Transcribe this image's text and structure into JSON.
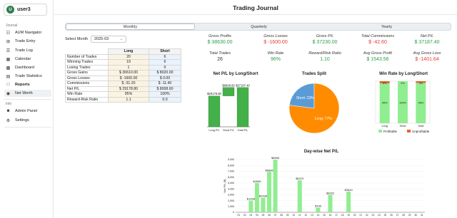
{
  "sidebar": {
    "user_initial": "U",
    "user_name": "user3",
    "section_journal": "Journal",
    "journal_items": [
      {
        "label": "AUM Navigator",
        "icon": "navigator-icon"
      },
      {
        "label": "Trade Entry",
        "icon": "plus-icon"
      },
      {
        "label": "Trade Log",
        "icon": "list-icon"
      },
      {
        "label": "Calendar",
        "icon": "calendar-icon"
      },
      {
        "label": "Dashboard",
        "icon": "dashboard-icon"
      },
      {
        "label": "Trade Statistics",
        "icon": "statistics-icon"
      },
      {
        "label": "Reports",
        "icon": "reports-icon"
      },
      {
        "label": "Net Worth",
        "icon": "dollar-icon"
      }
    ],
    "section_info": "Info",
    "info_items": [
      {
        "label": "Admin Panel",
        "icon": "person-icon"
      },
      {
        "label": "Settings",
        "icon": "gear-icon"
      }
    ]
  },
  "header": {
    "title": "Trading Journal"
  },
  "tabs": [
    "Monthly",
    "Quarterly",
    "Yearly"
  ],
  "month_select": {
    "label": "Select Month",
    "value": "2025-03"
  },
  "stats_table": {
    "headers": [
      "",
      "Long",
      "Short"
    ],
    "rows": [
      [
        "Number of Trades",
        "20",
        "6"
      ],
      [
        "Winning Trades",
        "19",
        "6"
      ],
      [
        "Losing Trades",
        "1",
        "0"
      ],
      [
        "Gross Gains",
        "$ 30610.00",
        "$ 8020.00"
      ],
      [
        "Gross Losses",
        "$ -1600.00",
        "$ 0.00"
      ],
      [
        "Commissions",
        "$ -31.20",
        "$ -11.40"
      ],
      [
        "Net P/L",
        "$ 29178.80",
        "$ 8008.60"
      ],
      [
        "Win Rate",
        "95%",
        "100%"
      ],
      [
        "Reward-Risk Ratio",
        "1.1",
        "0.0"
      ]
    ]
  },
  "metrics": [
    {
      "label": "Gross Profits",
      "value": "$ 38630.00",
      "color": "#2e9e4a"
    },
    {
      "label": "Gross Losses",
      "value": "$ -1600.00",
      "color": "#e53935"
    },
    {
      "label": "Gross P/L",
      "value": "$ 37230.00",
      "color": "#2e9e4a"
    },
    {
      "label": "Total Commissions",
      "value": "$ -42.60",
      "color": "#e53935"
    },
    {
      "label": "Net P/L",
      "value": "$ 37187.40",
      "color": "#2e9e4a"
    },
    {
      "label": "Total Trades",
      "value": "26",
      "color": "#333333"
    },
    {
      "label": "Win Rate",
      "value": "96%",
      "color": "#2e9e4a"
    },
    {
      "label": "Reward/Risk Ratio",
      "value": "1.10",
      "color": "#2e9e4a"
    },
    {
      "label": "Avg Gross Profit",
      "value": "$ 1543.56",
      "color": "#2e9e4a"
    },
    {
      "label": "Avg Gross Loss",
      "value": "$ -1401.64",
      "color": "#e53935"
    }
  ],
  "chart_data": [
    {
      "type": "bar",
      "title": "Net P/L by Long/Short",
      "categories": [
        "Long P/L",
        "Short P/L",
        "Total P/L"
      ],
      "values": [
        29178.8,
        8008.6,
        37187.4
      ],
      "value_labels": [
        "$29178.80",
        "$8008.60",
        "$37187.40"
      ],
      "colors": [
        "#43b04a",
        "#43b04a",
        "#43b04a"
      ]
    },
    {
      "type": "pie",
      "title": "Trades Split",
      "labels": [
        "Short",
        "Long"
      ],
      "values": [
        23,
        77
      ],
      "slice_labels": [
        "Short: 23%",
        "Long: 77%"
      ],
      "colors": [
        "#5b9bd5",
        "#ff8c00"
      ]
    },
    {
      "type": "bar",
      "title": "Win Rate by Long/Short",
      "categories": [
        "Long",
        "Short",
        "Total"
      ],
      "series": [
        {
          "name": "Profitable",
          "values": [
            95,
            100,
            96
          ],
          "color": "#90ee90"
        },
        {
          "name": "Unprofitable",
          "values": [
            5,
            0,
            4
          ],
          "color": "#e8622c"
        }
      ],
      "top_labels": [
        "5%",
        "0%",
        "4%"
      ],
      "mid_labels": [
        "95%",
        "100%",
        "96%"
      ]
    },
    {
      "type": "bar",
      "title": "Day-wise Net P/L",
      "categories": [
        "01",
        "02",
        "03",
        "04",
        "05",
        "06",
        "07",
        "08",
        "09",
        "10",
        "11",
        "12",
        "13",
        "14",
        "15",
        "16",
        "17",
        "18",
        "19",
        "20",
        "21",
        "22",
        "23",
        "24",
        "25",
        "26",
        "27",
        "28",
        "29",
        "30",
        "31"
      ],
      "values": [
        0,
        0,
        1998,
        4996,
        2498,
        6896,
        8996,
        0,
        0,
        0,
        5470,
        0,
        0,
        796,
        0,
        3002,
        0,
        0,
        3544,
        0,
        0,
        0,
        0,
        0,
        0,
        0,
        0,
        0,
        0,
        0,
        0
      ],
      "value_labels": {
        "2": "$1998",
        "3": "$4996",
        "4": "$2498",
        "5": "$6896",
        "6": "$8996",
        "10": "$5470",
        "13": "$796",
        "15": "$3002",
        "18": "$3544"
      },
      "ylim": [
        0,
        9000
      ],
      "yticks": [
        "0",
        "1,000",
        "2,000",
        "3,000",
        "4,000",
        "5,000",
        "6,000",
        "7,000",
        "8,000",
        "9,000"
      ],
      "ylabel": "Net P/L ($)",
      "color": "#90ee90"
    }
  ]
}
